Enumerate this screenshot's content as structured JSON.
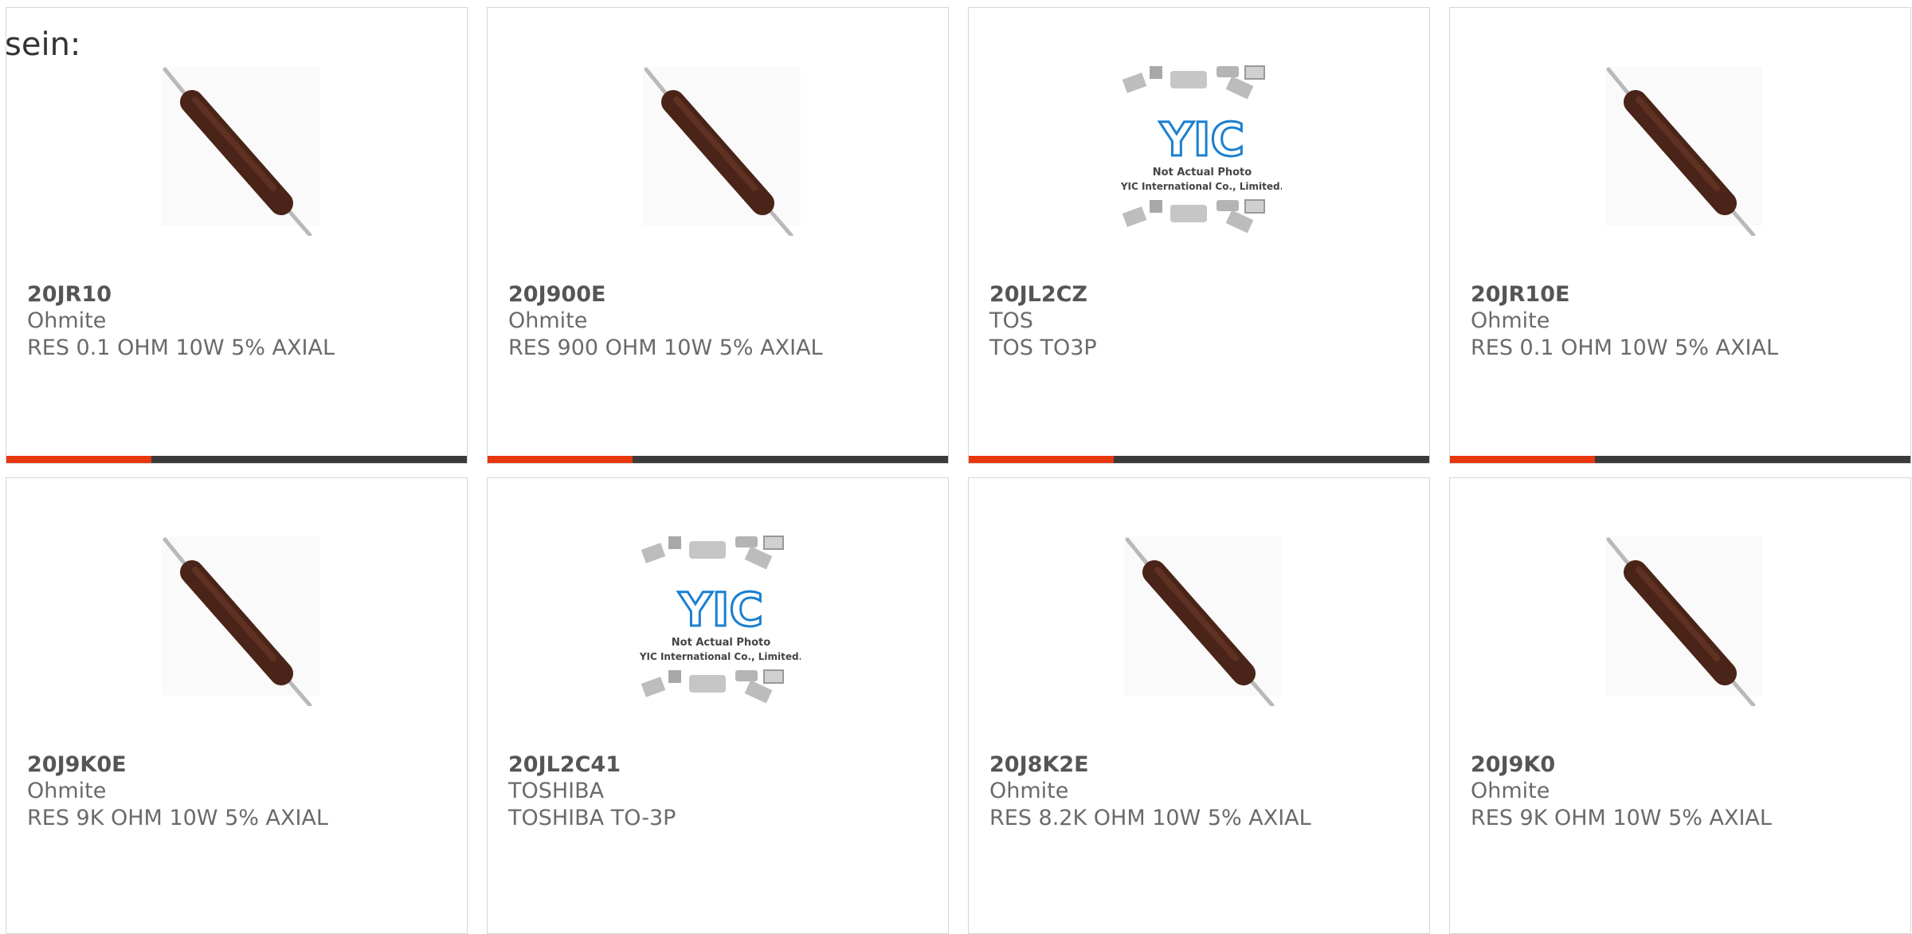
{
  "intro_text": "sein:",
  "colors": {
    "accent": "#e8360e",
    "bar_dark": "#3b3b3b",
    "border": "#d6d6d6",
    "resistor_body": "#4a2418",
    "yic_blue": "#1a7fd0"
  },
  "products": [
    {
      "part_number": "20JR10",
      "brand": "Ohmite",
      "description": "RES 0.1 OHM 10W 5% AXIAL",
      "image": "resistor-axial-icon"
    },
    {
      "part_number": "20J900E",
      "brand": "Ohmite",
      "description": "RES 900 OHM 10W 5% AXIAL",
      "image": "resistor-axial-icon"
    },
    {
      "part_number": "20JL2CZ",
      "brand": "TOS",
      "description": "TOS TO3P",
      "image": "yic-placeholder-icon",
      "placeholder_line1": "Not Actual Photo",
      "placeholder_line2": "YIC International Co., Limited.",
      "placeholder_logo": "YIC"
    },
    {
      "part_number": "20JR10E",
      "brand": "Ohmite",
      "description": "RES 0.1 OHM 10W 5% AXIAL",
      "image": "resistor-axial-icon"
    },
    {
      "part_number": "20J9K0E",
      "brand": "Ohmite",
      "description": "RES 9K OHM 10W 5% AXIAL",
      "image": "resistor-axial-icon"
    },
    {
      "part_number": "20JL2C41",
      "brand": "TOSHIBA",
      "description": "TOSHIBA TO-3P",
      "image": "yic-placeholder-icon",
      "placeholder_line1": "Not Actual Photo",
      "placeholder_line2": "YIC International Co., Limited.",
      "placeholder_logo": "YIC"
    },
    {
      "part_number": "20J8K2E",
      "brand": "Ohmite",
      "description": "RES 8.2K OHM 10W 5% AXIAL",
      "image": "resistor-axial-icon"
    },
    {
      "part_number": "20J9K0",
      "brand": "Ohmite",
      "description": "RES 9K OHM 10W 5% AXIAL",
      "image": "resistor-axial-icon"
    }
  ]
}
